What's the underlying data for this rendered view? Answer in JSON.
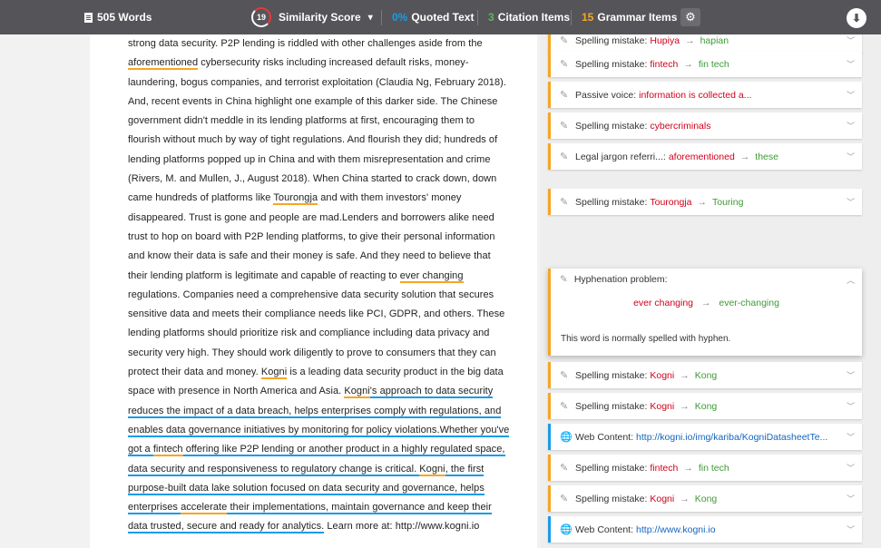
{
  "toolbar": {
    "word_count": "505 Words",
    "similarity_score": "19",
    "similarity_label": "Similarity Score",
    "quoted_pct": "0%",
    "quoted_label": "Quoted Text",
    "citation_count": "3",
    "citation_label": "Citation Items",
    "grammar_count": "15",
    "grammar_label": "Grammar Items",
    "icons": [
      "document-icon",
      "chevron-down-icon",
      "gear-icon",
      "download-icon"
    ],
    "colors": {
      "bar": "#555459",
      "quoted": "#1a9be6",
      "citation": "#5cb85c",
      "grammar": "#f5a623",
      "score_ring": "#e43a3a"
    }
  },
  "document": {
    "lines": [
      [
        "strong data security.  P2P lending is riddled with other challenges aside from the"
      ],
      [
        "",
        "aforementioned",
        " cybersecurity risks including increased default risks, money-"
      ],
      [
        "laundering, bogus companies, and terrorist exploitation (Claudia Ng, February 2018)."
      ],
      [
        "And, recent events in China highlight one example of this darker side.  The Chinese"
      ],
      [
        "government didn't meddle in its lending platforms at first, encouraging them to"
      ],
      [
        "flourish without much by way of tight regulations.  And flourish they did; hundreds of"
      ],
      [
        "lending platforms popped up in China and with them misrepresentation and crime"
      ],
      [
        "(Rivers, M. and Mullen, J., August 2018).  When China started to crack down, down"
      ],
      [
        "came hundreds of platforms like ",
        "Tourongja",
        " and with them investors' money"
      ],
      [
        "disappeared.  Trust is gone and people are mad.Lenders and borrowers alike need"
      ],
      [
        "trust to hop on board with P2P lending platforms, to give their personal information"
      ],
      [
        "and know their data is safe and their money is safe. And they need to believe that"
      ],
      [
        "their lending platform is legitimate and capable of reacting to ",
        "ever changing"
      ],
      [
        "regulations.  Companies need a comprehensive data security solution that secures"
      ],
      [
        "sensitive data and meets their compliance needs like PCI, GDPR, and others. These"
      ],
      [
        "lending platforms should prioritize risk and compliance including data privacy and"
      ],
      [
        "security very high.  They should work diligently to prove to consumers that they can"
      ],
      [
        "protect their data and money.  ",
        "Kogni",
        " is a leading data security product in the big data"
      ],
      [
        "space with presence in North America and Asia.  ",
        "Kogni",
        "'s approach to data security"
      ],
      [
        "reduces the impact of a data breach, helps enterprises comply with regulations, and"
      ],
      [
        "enables data governance initiatives by monitoring for policy violations.Whether you've"
      ],
      [
        "got a ",
        "fintech",
        " offering like P2P lending or another product in a highly regulated space,"
      ],
      [
        "data security and responsiveness to regulatory change is critical.  ",
        "Kogni",
        ", the first"
      ],
      [
        "purpose-built data lake solution focused on data security and governance, helps"
      ],
      [
        "enterprises ",
        "accelerate",
        " their implementations, maintain governance and keep their"
      ],
      [
        "data trusted, secure and ready for analytics.",
        " Learn more at: http://www.kogni.io"
      ]
    ]
  },
  "panel": {
    "cards": [
      {
        "label": "Spelling mistake:",
        "bad": "Hupiya",
        "good": "hapian",
        "icon": "pencil-icon",
        "kind": "grammar"
      },
      {
        "label": "Spelling mistake:",
        "bad": "fintech",
        "good": "fin tech",
        "icon": "pencil-icon",
        "kind": "grammar"
      },
      {
        "label": "Passive voice:",
        "bad": "information is collected a...",
        "good": "",
        "icon": "pencil-icon",
        "kind": "grammar"
      },
      {
        "label": "Spelling mistake:",
        "bad": "cybercriminals",
        "good": "",
        "icon": "pencil-icon",
        "kind": "grammar"
      },
      {
        "label": "Legal jargon referri...:",
        "bad": "aforementioned",
        "good": "these",
        "icon": "pencil-icon",
        "kind": "grammar"
      },
      {
        "label": "Spelling mistake:",
        "bad": "Tourongja",
        "good": "Touring",
        "icon": "pencil-icon",
        "kind": "grammar"
      },
      {
        "label": "Spelling mistake:",
        "bad": "Kogni",
        "good": "Kong",
        "icon": "pencil-icon",
        "kind": "grammar"
      },
      {
        "label": "Spelling mistake:",
        "bad": "Kogni",
        "good": "Kong",
        "icon": "pencil-icon",
        "kind": "grammar"
      },
      {
        "label": "Web Content:",
        "link": "http://kogni.io/img/kariba/KogniDatasheetTe...",
        "icon": "globe-icon",
        "kind": "citation"
      },
      {
        "label": "Spelling mistake:",
        "bad": "fintech",
        "good": "fin tech",
        "icon": "pencil-icon",
        "kind": "grammar"
      },
      {
        "label": "Spelling mistake:",
        "bad": "Kogni",
        "good": "Kong",
        "icon": "pencil-icon",
        "kind": "grammar"
      },
      {
        "label": "Web Content:",
        "link": "http://www.kogni.io",
        "icon": "globe-icon",
        "kind": "citation"
      }
    ],
    "expanded": {
      "label": "Hyphenation problem:",
      "bad": "ever changing",
      "good": "ever-changing",
      "description": "This word is normally spelled with hyphen."
    }
  }
}
